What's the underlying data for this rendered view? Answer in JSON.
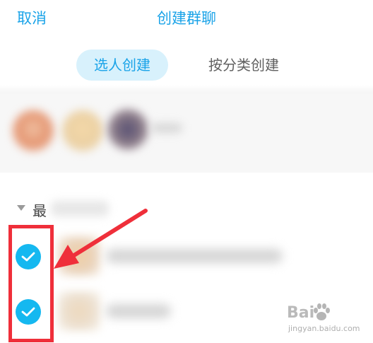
{
  "header": {
    "cancel_label": "取消",
    "title": "创建群聊"
  },
  "tabs": [
    {
      "label": "选人创建",
      "active": true
    },
    {
      "label": "按分类创建",
      "active": false
    }
  ],
  "section": {
    "title_visible": "最"
  },
  "contacts": [
    {
      "selected": true,
      "check_icon": "check-icon"
    },
    {
      "selected": true,
      "check_icon": "check-icon"
    }
  ],
  "watermark": {
    "brand": "Bai",
    "url": "jingyan.baidu.com"
  },
  "colors": {
    "accent": "#1aa3e8",
    "tab_active_bg": "#d8f1fc",
    "check_fill": "#15b8f0",
    "annotation_red": "#ef2f3a"
  }
}
